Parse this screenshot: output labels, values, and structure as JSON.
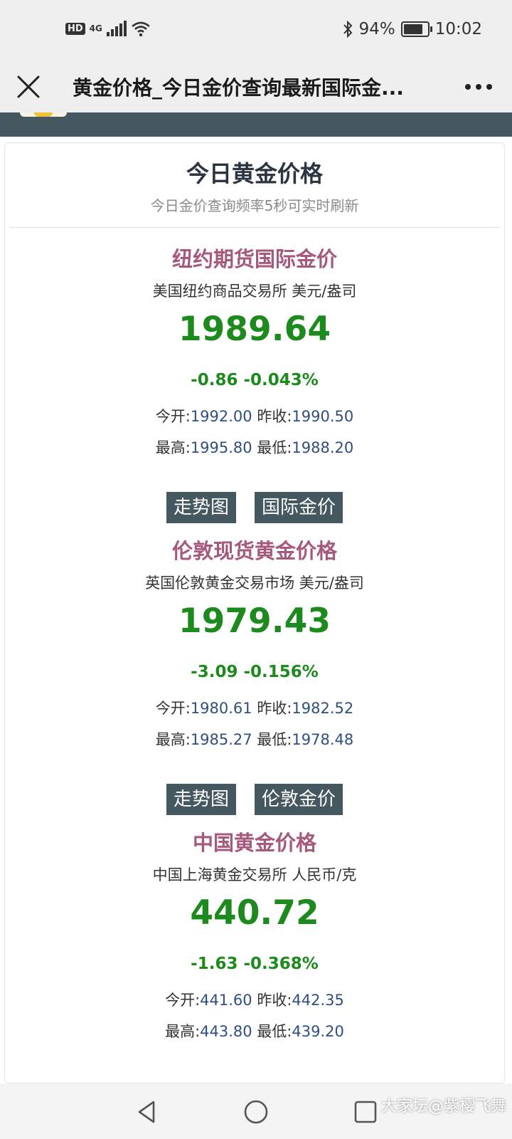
{
  "status_bar": {
    "hd": "HD",
    "network": "4G",
    "battery_percent": "94%",
    "battery_level": 0.94,
    "time": "10:02"
  },
  "nav": {
    "title": "黄金价格_今日金价查询最新国际金..."
  },
  "page": {
    "title": "今日黄金价格",
    "subtitle": "今日金价查询频率5秒可实时刷新"
  },
  "sections": [
    {
      "title": "纽约期货国际金价",
      "subtitle": "美国纽约商品交易所 美元/盎司",
      "price": "1989.64",
      "change": "-0.86 -0.043%",
      "open_label": "今开:",
      "open": "1992.00",
      "prev_label": "昨收:",
      "prev": "1990.50",
      "high_label": "最高:",
      "high": "1995.80",
      "low_label": "最低:",
      "low": "1988.20",
      "buttons": [
        "走势图",
        "国际金价"
      ]
    },
    {
      "title": "伦敦现货黄金价格",
      "subtitle": "英国伦敦黄金交易市场 美元/盎司",
      "price": "1979.43",
      "change": "-3.09 -0.156%",
      "open_label": "今开:",
      "open": "1980.61",
      "prev_label": "昨收:",
      "prev": "1982.52",
      "high_label": "最高:",
      "high": "1985.27",
      "low_label": "最低:",
      "low": "1978.48",
      "buttons": [
        "走势图",
        "伦敦金价"
      ]
    },
    {
      "title": "中国黄金价格",
      "subtitle": "中国上海黄金交易所 人民币/克",
      "price": "440.72",
      "change": "-1.63 -0.368%",
      "open_label": "今开:",
      "open": "441.60",
      "prev_label": "昨收:",
      "prev": "442.35",
      "high_label": "最高:",
      "high": "443.80",
      "low_label": "最低:",
      "low": "439.20"
    }
  ],
  "watermark": "大家坛@紫樱飞舞",
  "colors": {
    "header": "#45575f",
    "section_title": "#a6587d",
    "price_green": "#1d8a1d",
    "value_blue": "#2f4f80"
  }
}
